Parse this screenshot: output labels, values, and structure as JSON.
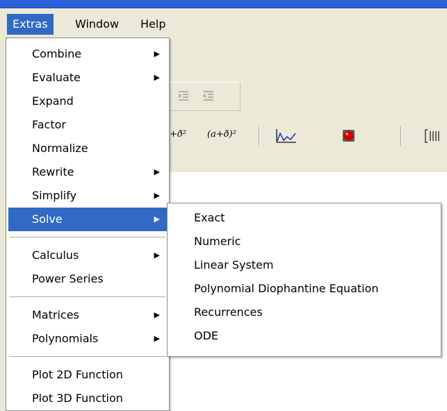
{
  "menubar": {
    "items": [
      {
        "label": "Extras",
        "active": true
      },
      {
        "label": "Window",
        "active": false
      },
      {
        "label": "Help",
        "active": false
      }
    ]
  },
  "toolbar": {
    "expressions": [
      "+ð²",
      "(a+ð)²"
    ],
    "icons": [
      "indent-icon",
      "outdent-icon",
      "plot-icon",
      "solid-icon",
      "matrix-icon"
    ]
  },
  "extras_menu": {
    "items": [
      {
        "label": "Combine",
        "submenu": true
      },
      {
        "label": "Evaluate",
        "submenu": true
      },
      {
        "label": "Expand",
        "submenu": false
      },
      {
        "label": "Factor",
        "submenu": false
      },
      {
        "label": "Normalize",
        "submenu": false
      },
      {
        "label": "Rewrite",
        "submenu": true
      },
      {
        "label": "Simplify",
        "submenu": true
      },
      {
        "label": "Solve",
        "submenu": true,
        "highlighted": true
      },
      {
        "label": "Calculus",
        "submenu": true
      },
      {
        "label": "Power Series",
        "submenu": false
      },
      {
        "label": "Matrices",
        "submenu": true
      },
      {
        "label": "Polynomials",
        "submenu": true
      },
      {
        "label": "Plot 2D Function",
        "submenu": false
      },
      {
        "label": "Plot 3D Function",
        "submenu": false
      }
    ],
    "arrow_glyph": "▶"
  },
  "solve_submenu": {
    "items": [
      {
        "label": "Exact"
      },
      {
        "label": "Numeric"
      },
      {
        "label": "Linear System"
      },
      {
        "label": "Polynomial Diophantine Equation"
      },
      {
        "label": "Recurrences"
      },
      {
        "label": "ODE"
      }
    ]
  },
  "colors": {
    "highlight": "#316ac5",
    "menubar": "#ece9d8",
    "menu_background": "#ffffff",
    "plot_accent": "#1a3fb0",
    "solid_accent": "#d40000"
  }
}
